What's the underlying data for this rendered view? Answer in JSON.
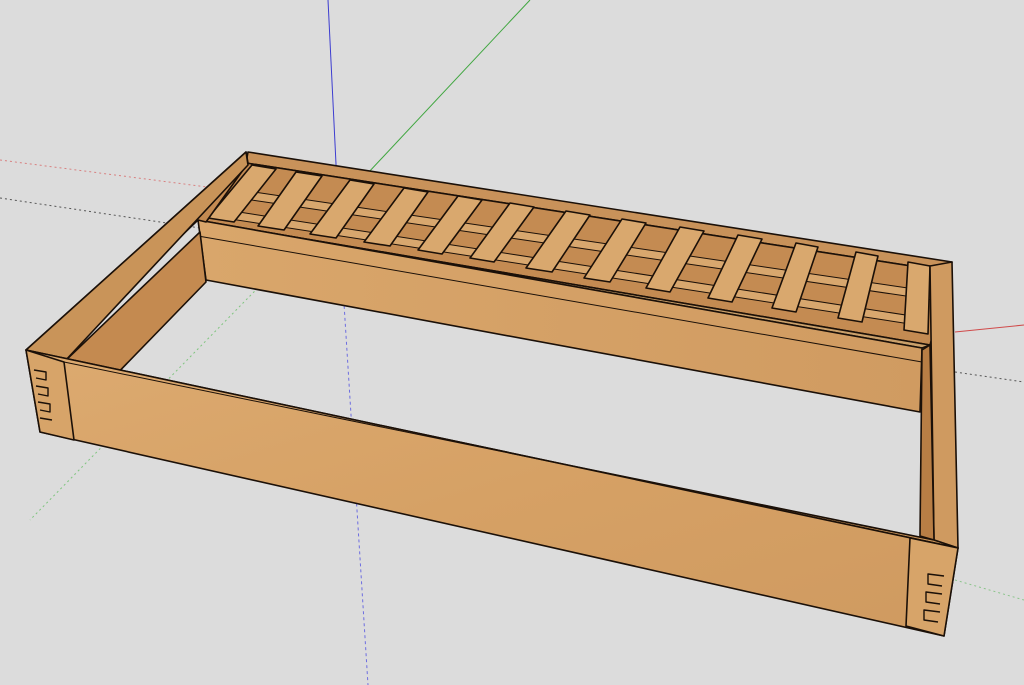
{
  "scene": {
    "background_color": "#dcdcdc",
    "model": "wooden-tray-frame-with-slats",
    "axis_colors": {
      "red": "#d04a4a",
      "green": "#3fa63f",
      "blue": "#3d3dd0"
    },
    "wood_colors": {
      "face": "#d7a469",
      "face_light": "#e2b47c",
      "top_edge": "#c8925a",
      "inner": "#c98d55",
      "shadow": "#a86f3c",
      "outline": "#1b1008"
    },
    "slat_count": 13
  }
}
